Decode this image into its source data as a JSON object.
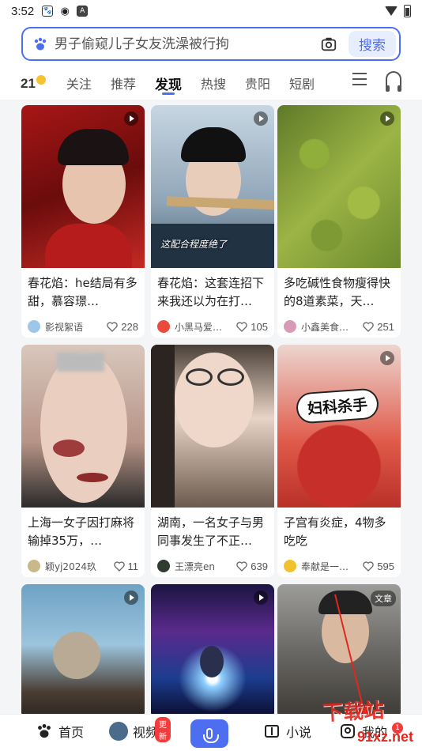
{
  "status_bar": {
    "time": "3:52"
  },
  "search": {
    "placeholder": "男子偷窥儿子女友洗澡被行拘",
    "button_label": "搜索"
  },
  "tabs": {
    "logo": "21",
    "items": [
      {
        "label": "关注",
        "active": false
      },
      {
        "label": "推荐",
        "active": false
      },
      {
        "label": "发现",
        "active": true
      },
      {
        "label": "热搜",
        "active": false
      },
      {
        "label": "贵阳",
        "active": false
      },
      {
        "label": "短剧",
        "active": false
      }
    ]
  },
  "feed": [
    {
      "title": "春花焰：he结局有多甜，慕容璟…",
      "author": "影视絮语",
      "likes": "228",
      "video": true
    },
    {
      "title": "春花焰：这套连招下来我还以为在打…",
      "author": "小黑马爱…",
      "likes": "105",
      "video": true,
      "overlay": "这配合程度绝了"
    },
    {
      "title": "多吃碱性食物瘦得快的8道素菜，天…",
      "author": "小鑫美食…",
      "likes": "251",
      "video": true
    },
    {
      "title": "上海一女子因打麻将输掉35万，…",
      "author": "颖yj2024玖",
      "likes": "11",
      "video": false
    },
    {
      "title": "湖南，一名女子与男同事发生了不正…",
      "author": "王漂亮en",
      "likes": "639",
      "video": false
    },
    {
      "title": "子宫有炎症，4物多吃吃",
      "author": "奉献是一…",
      "likes": "595",
      "video": true,
      "overlay": "妇科杀手"
    },
    {
      "title": "",
      "author": "",
      "likes": "",
      "video": true
    },
    {
      "title": "",
      "author": "",
      "likes": "",
      "video": true
    },
    {
      "title": "",
      "author": "",
      "likes": "",
      "video": false,
      "tag": "文章"
    }
  ],
  "bottom_nav": {
    "home": "首页",
    "video": "视频",
    "video_badge": "更新",
    "novel": "小说",
    "mine": "我的",
    "mine_badge": "1"
  },
  "watermark": {
    "line1": "下载站",
    "line2": "91xz.net"
  }
}
